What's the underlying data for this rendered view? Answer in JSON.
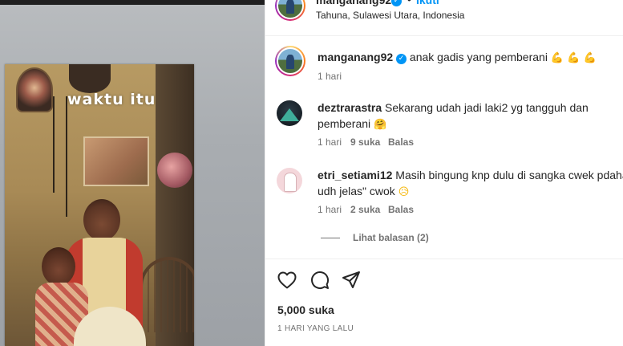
{
  "post": {
    "image_caption_overlay": "waktu itu",
    "header": {
      "username": "manganang92",
      "separator": "•",
      "follow_label": "Ikuti",
      "location": "Tahuna, Sulawesi Utara, Indonesia"
    },
    "caption": {
      "username": "manganang92",
      "text": "anak gadis yang pemberani",
      "emoji": "💪 💪 💪",
      "time": "1 hari"
    },
    "comments": [
      {
        "username": "deztrarastra",
        "text_line1": "Sekarang udah jadi laki2 yg tangguh dan",
        "text_line2": "pemberani",
        "emoji": "🤗",
        "time": "1 hari",
        "likes": "9 suka",
        "reply_label": "Balas"
      },
      {
        "username": "etri_setiami12",
        "text_line1": "Masih bingung knp dulu di sangka cwek pdaha",
        "text_line2": "udh jelas\" cwok",
        "emoji": "😥",
        "time": "1 hari",
        "likes": "2 suka",
        "reply_label": "Balas",
        "view_replies": "Lihat balasan (2)"
      }
    ],
    "actions": {
      "like_icon": "heart-icon",
      "comment_icon": "comment-icon",
      "share_icon": "send-icon"
    },
    "likes_count": "5,000 suka",
    "posted_ago": "1 HARI YANG LALU"
  },
  "colors": {
    "link_blue": "#0095f6",
    "text_primary": "#262626",
    "text_secondary": "#737373",
    "divider": "#efefef"
  }
}
